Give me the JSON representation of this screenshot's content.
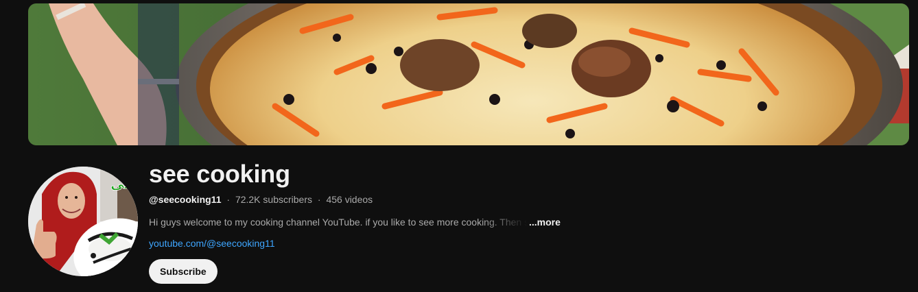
{
  "channel": {
    "name": "see cooking",
    "handle": "@seecooking11",
    "subscribers": "72.2K subscribers",
    "videos": "456 videos",
    "separator": "·",
    "description": "Hi guys welcome to my cooking channel YouTube.  if you like to see more cooking. Then subscribe",
    "more_label": "...more",
    "link": "youtube.com/@seecooking11",
    "subscribe_label": "Subscribe"
  },
  "avatar": {
    "overlay_text": "کی"
  },
  "colors": {
    "background": "#0f0f0f",
    "link": "#3ea6ff",
    "text_primary": "#f1f1f1",
    "text_secondary": "#aaaaaa",
    "subscribe_bg": "#f1f1f1"
  }
}
